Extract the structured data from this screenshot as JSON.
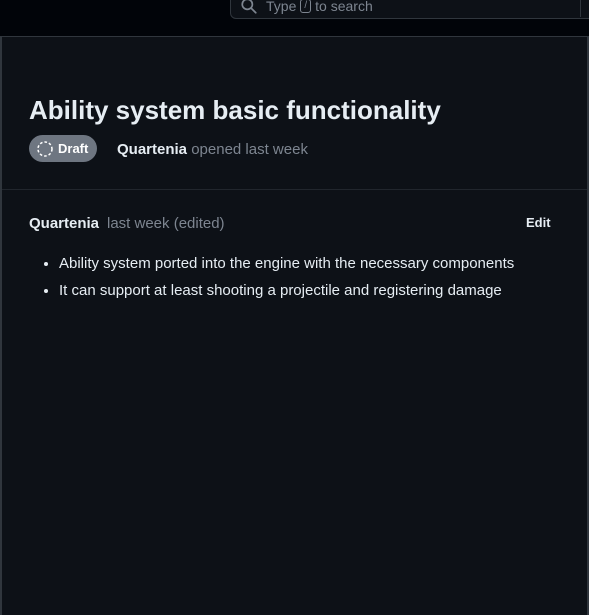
{
  "search": {
    "placeholder_before": "Type",
    "shortcut_key": "/",
    "placeholder_after": "to search"
  },
  "pull_request": {
    "title": "Ability system basic functionality",
    "state_badge": "Draft",
    "author": "Quartenia",
    "opened_text": "opened last week"
  },
  "comment": {
    "author": "Quartenia",
    "timestamp": "last week (edited)",
    "edit_label": "Edit",
    "body_items": [
      "Ability system ported into the engine with the necessary components",
      "It can support at least shooting a projectile and registering damage"
    ]
  },
  "colors": {
    "background": "#0d1117",
    "draft_badge": "#6e7681",
    "muted_text": "#7d8590",
    "primary_text": "#e6edf3"
  },
  "icons": {
    "search": "search-icon",
    "draft": "draft-pr-icon"
  }
}
